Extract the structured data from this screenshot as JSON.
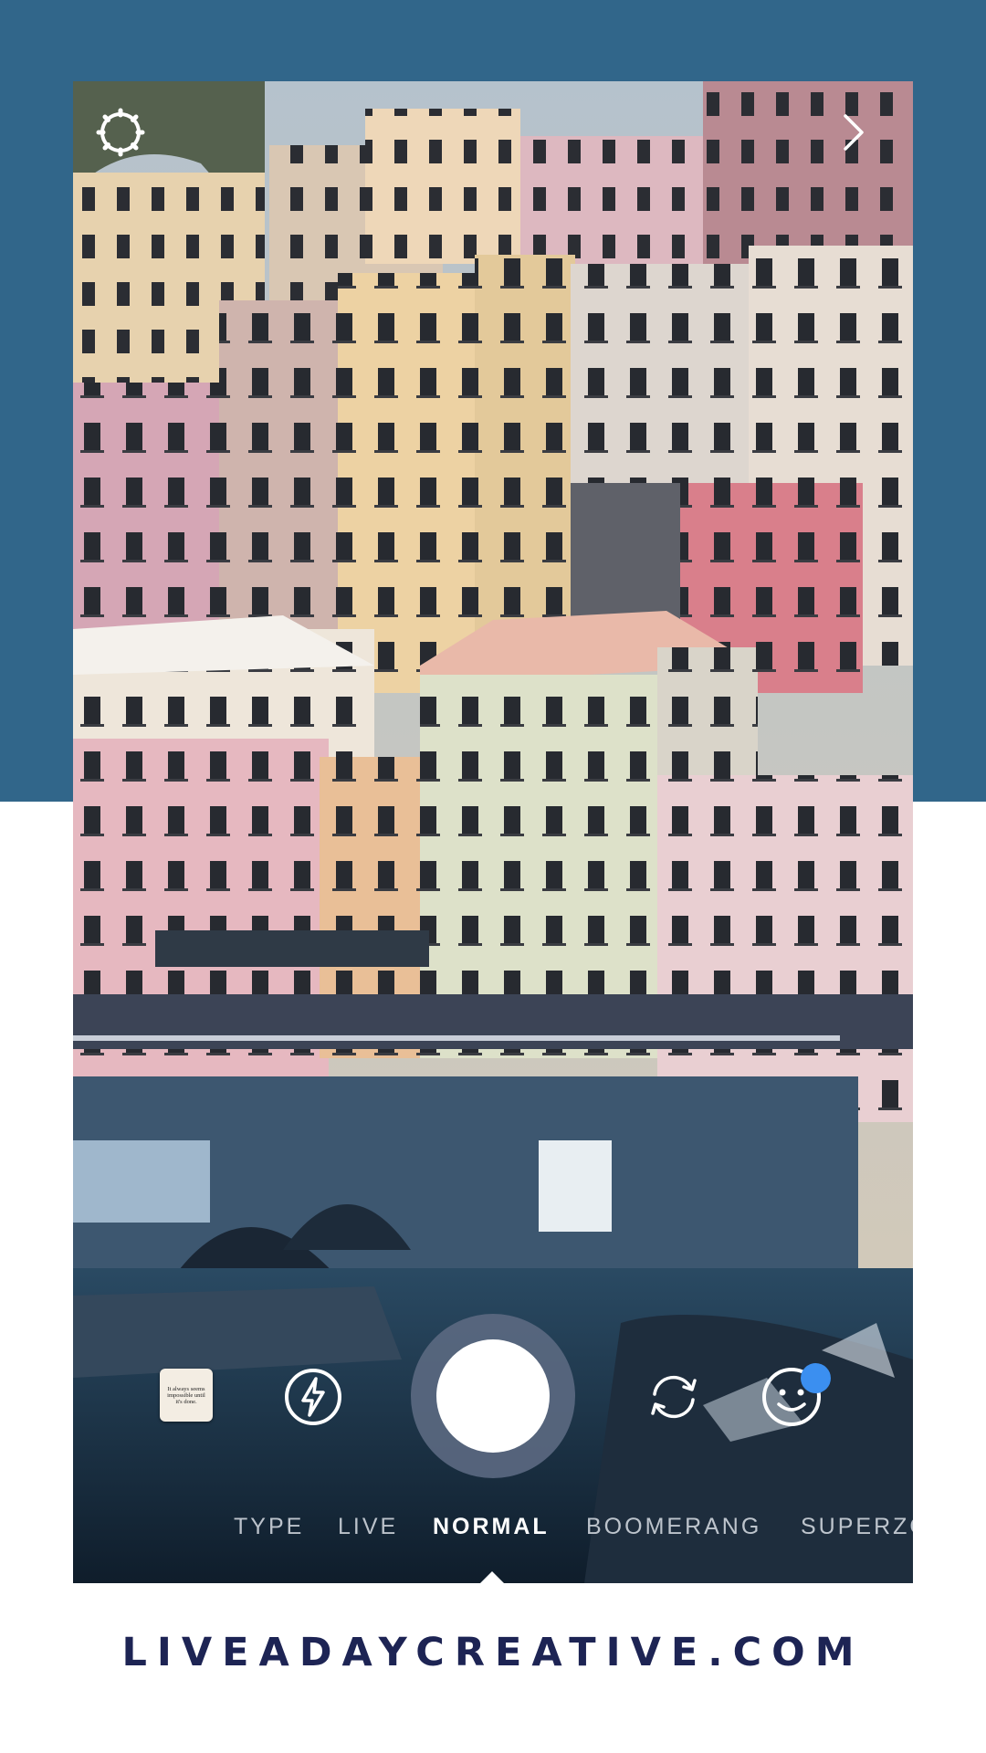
{
  "camera": {
    "story_thumbnail_text": "It always seems impossible until it's done.",
    "capture_modes": [
      "TYPE",
      "LIVE",
      "NORMAL",
      "BOOMERANG",
      "SUPERZO"
    ],
    "active_mode": "NORMAL",
    "icons": {
      "settings": "settings-gear-icon",
      "next": "chevron-right-icon",
      "flash": "flash-icon",
      "flip": "flip-camera-icon",
      "effects": "face-effects-icon"
    },
    "notification_dot_color": "#3b8ff0"
  },
  "branding": {
    "site_url": "LIVEADAYCREATIVE.COM",
    "band_color": "#31668a",
    "text_color": "#1d2454"
  }
}
